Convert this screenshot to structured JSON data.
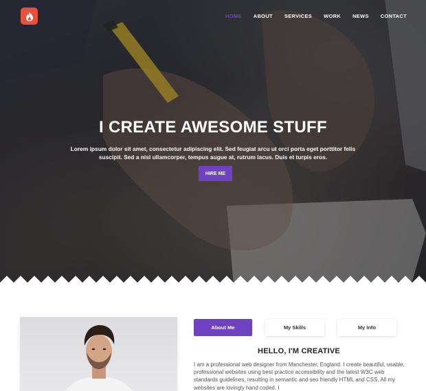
{
  "nav": {
    "logo": "flame-logo",
    "items": [
      {
        "label": "HOME",
        "active": true
      },
      {
        "label": "ABOUT",
        "active": false
      },
      {
        "label": "SERVICES",
        "active": false
      },
      {
        "label": "WORK",
        "active": false
      },
      {
        "label": "NEWS",
        "active": false
      },
      {
        "label": "CONTACT",
        "active": false
      }
    ]
  },
  "hero": {
    "title": "I CREATE AWESOME STUFF",
    "subtitle": "Lorem ipsum dolor sit amet, consectetur adipiscing elit. Sed feugiat arcu ut orci porta eget porttitor felis suscipit. Sed a nisl ullamcorper, tempus augue at, rutrum lacus. Duis et turpis eros.",
    "cta": "HIRE ME"
  },
  "about": {
    "tabs": [
      {
        "label": "About Me",
        "active": true
      },
      {
        "label": "My Skills",
        "active": false
      },
      {
        "label": "My Info",
        "active": false
      }
    ],
    "heading": "HELLO, I'M CREATIVE",
    "text": "I am a professional web designer from Manchester, England. I create beautiful, usable, professional websites using best practice accessibility and the latest W3C web standards guidelines, resulting in semantic and seo friendly HTML and CSS. All my websites are lovingly hand coded. I"
  },
  "colors": {
    "accent": "#6f42c1",
    "logo": "#e8513d"
  }
}
